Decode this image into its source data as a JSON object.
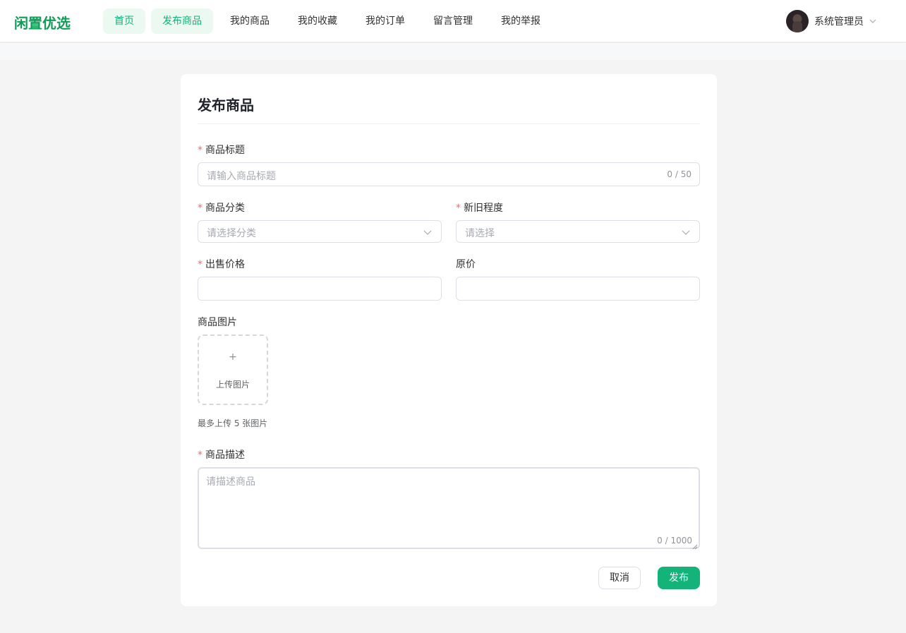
{
  "app": {
    "logo": "闲置优选"
  },
  "nav": {
    "items": [
      {
        "label": "首页",
        "active": true
      },
      {
        "label": "发布商品",
        "active": true
      },
      {
        "label": "我的商品",
        "active": false
      },
      {
        "label": "我的收藏",
        "active": false
      },
      {
        "label": "我的订单",
        "active": false
      },
      {
        "label": "留言管理",
        "active": false
      },
      {
        "label": "我的举报",
        "active": false
      }
    ]
  },
  "user": {
    "name": "系统管理员",
    "icon": "chevron-down-icon"
  },
  "form": {
    "title": "发布商品",
    "required_mark": "*",
    "item_title": {
      "label": "商品标题",
      "placeholder": "请输入商品标题",
      "value": "",
      "counter": "0 / 50"
    },
    "category": {
      "label": "商品分类",
      "placeholder": "请选择分类",
      "value": ""
    },
    "condition": {
      "label": "新旧程度",
      "placeholder": "请选择",
      "value": ""
    },
    "price": {
      "label": "出售价格",
      "value": ""
    },
    "original_price": {
      "label": "原价",
      "value": ""
    },
    "images": {
      "label": "商品图片",
      "upload_icon": "+",
      "upload_text": "上传图片",
      "hint": "最多上传 5 张图片"
    },
    "description": {
      "label": "商品描述",
      "placeholder": "请描述商品",
      "value": "",
      "counter": "0 / 1000"
    },
    "cancel_label": "取消",
    "publish_label": "发布"
  },
  "colors": {
    "brand": "#0f9d58",
    "accent": "#13b37a",
    "required": "#f56c6c"
  }
}
